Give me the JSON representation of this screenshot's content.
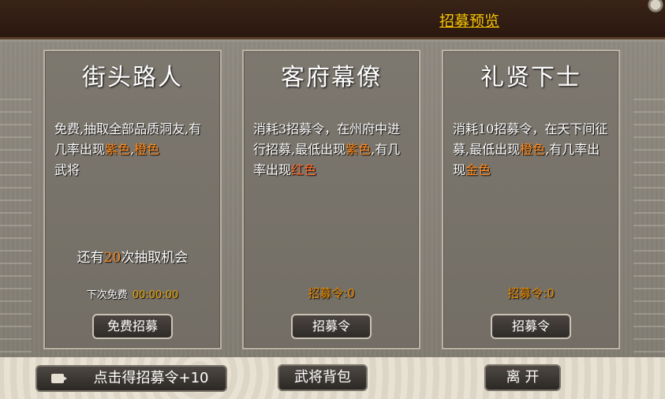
{
  "header": {
    "preview_label": "招募预览"
  },
  "cards": [
    {
      "title": "街头路人",
      "desc_parts": [
        "免费,抽取全部品质洞友,有几率出现",
        "紫色",
        ",",
        "橙色",
        "武将"
      ],
      "chances_prefix": "还有",
      "chances_num": "20",
      "chances_suffix": "次抽取机会",
      "next_free_label": "下次免费",
      "next_free_time": "00:00:00",
      "button_label": "免费招募"
    },
    {
      "title": "客府幕僚",
      "desc_parts": [
        "消耗3招募令，在州府中进行招募,最低出现",
        "紫色",
        ",有几率出现",
        "红色"
      ],
      "token_count": "招募令:0",
      "button_label": "招募令"
    },
    {
      "title": "礼贤下士",
      "desc_parts": [
        "消耗10招募令，在天下间征募,最低出现",
        "橙色",
        ",有几率出现",
        "金色"
      ],
      "token_count": "招募令:0",
      "button_label": "招募令"
    }
  ],
  "bottom": {
    "video_label": "点击得招募令+10",
    "bag_label": "武将背包",
    "leave_label": "离 开"
  },
  "icons": {
    "video": "video-camera-icon"
  },
  "colors": {
    "highlight": "#ff8a1e",
    "gold_link": "#f5c400"
  }
}
